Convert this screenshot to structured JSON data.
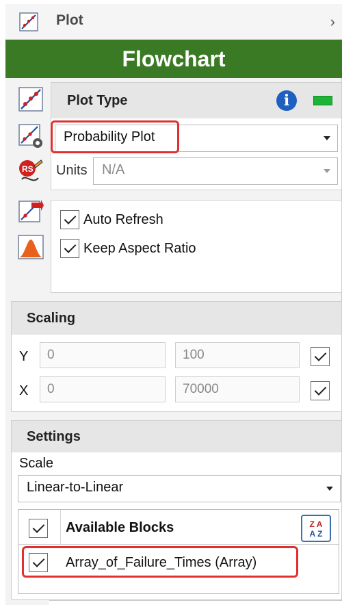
{
  "header": {
    "title": "Plot",
    "chevron": "›"
  },
  "banner": {
    "title": "Flowchart"
  },
  "left_icons": [
    "plot-icon",
    "plot-settings-icon",
    "rs-draw-icon",
    "plot-export-icon",
    "mountain-plot-icon"
  ],
  "plot_type": {
    "section_title": "Plot Type",
    "info_glyph": "i",
    "selected": "Probability Plot",
    "units_label": "Units",
    "units_value": "N/A"
  },
  "options": {
    "auto_refresh": "Auto Refresh",
    "keep_aspect_ratio": "Keep Aspect Ratio"
  },
  "scaling": {
    "section_title": "Scaling",
    "y_label": "Y",
    "y_min": "0",
    "y_max": "100",
    "x_label": "X",
    "x_min": "0",
    "x_max": "70000"
  },
  "settings": {
    "section_title": "Settings",
    "scale_label": "Scale",
    "scale_value": "Linear-to-Linear",
    "blocks_header": "Available Blocks",
    "sort_glyph_top": "Z A",
    "sort_glyph_bottom": "A Z",
    "block_item": "Array_of_Failure_Times (Array)"
  },
  "colors": {
    "banner": "#3a7a24",
    "highlight": "#e03030",
    "status_green": "#1db336"
  }
}
